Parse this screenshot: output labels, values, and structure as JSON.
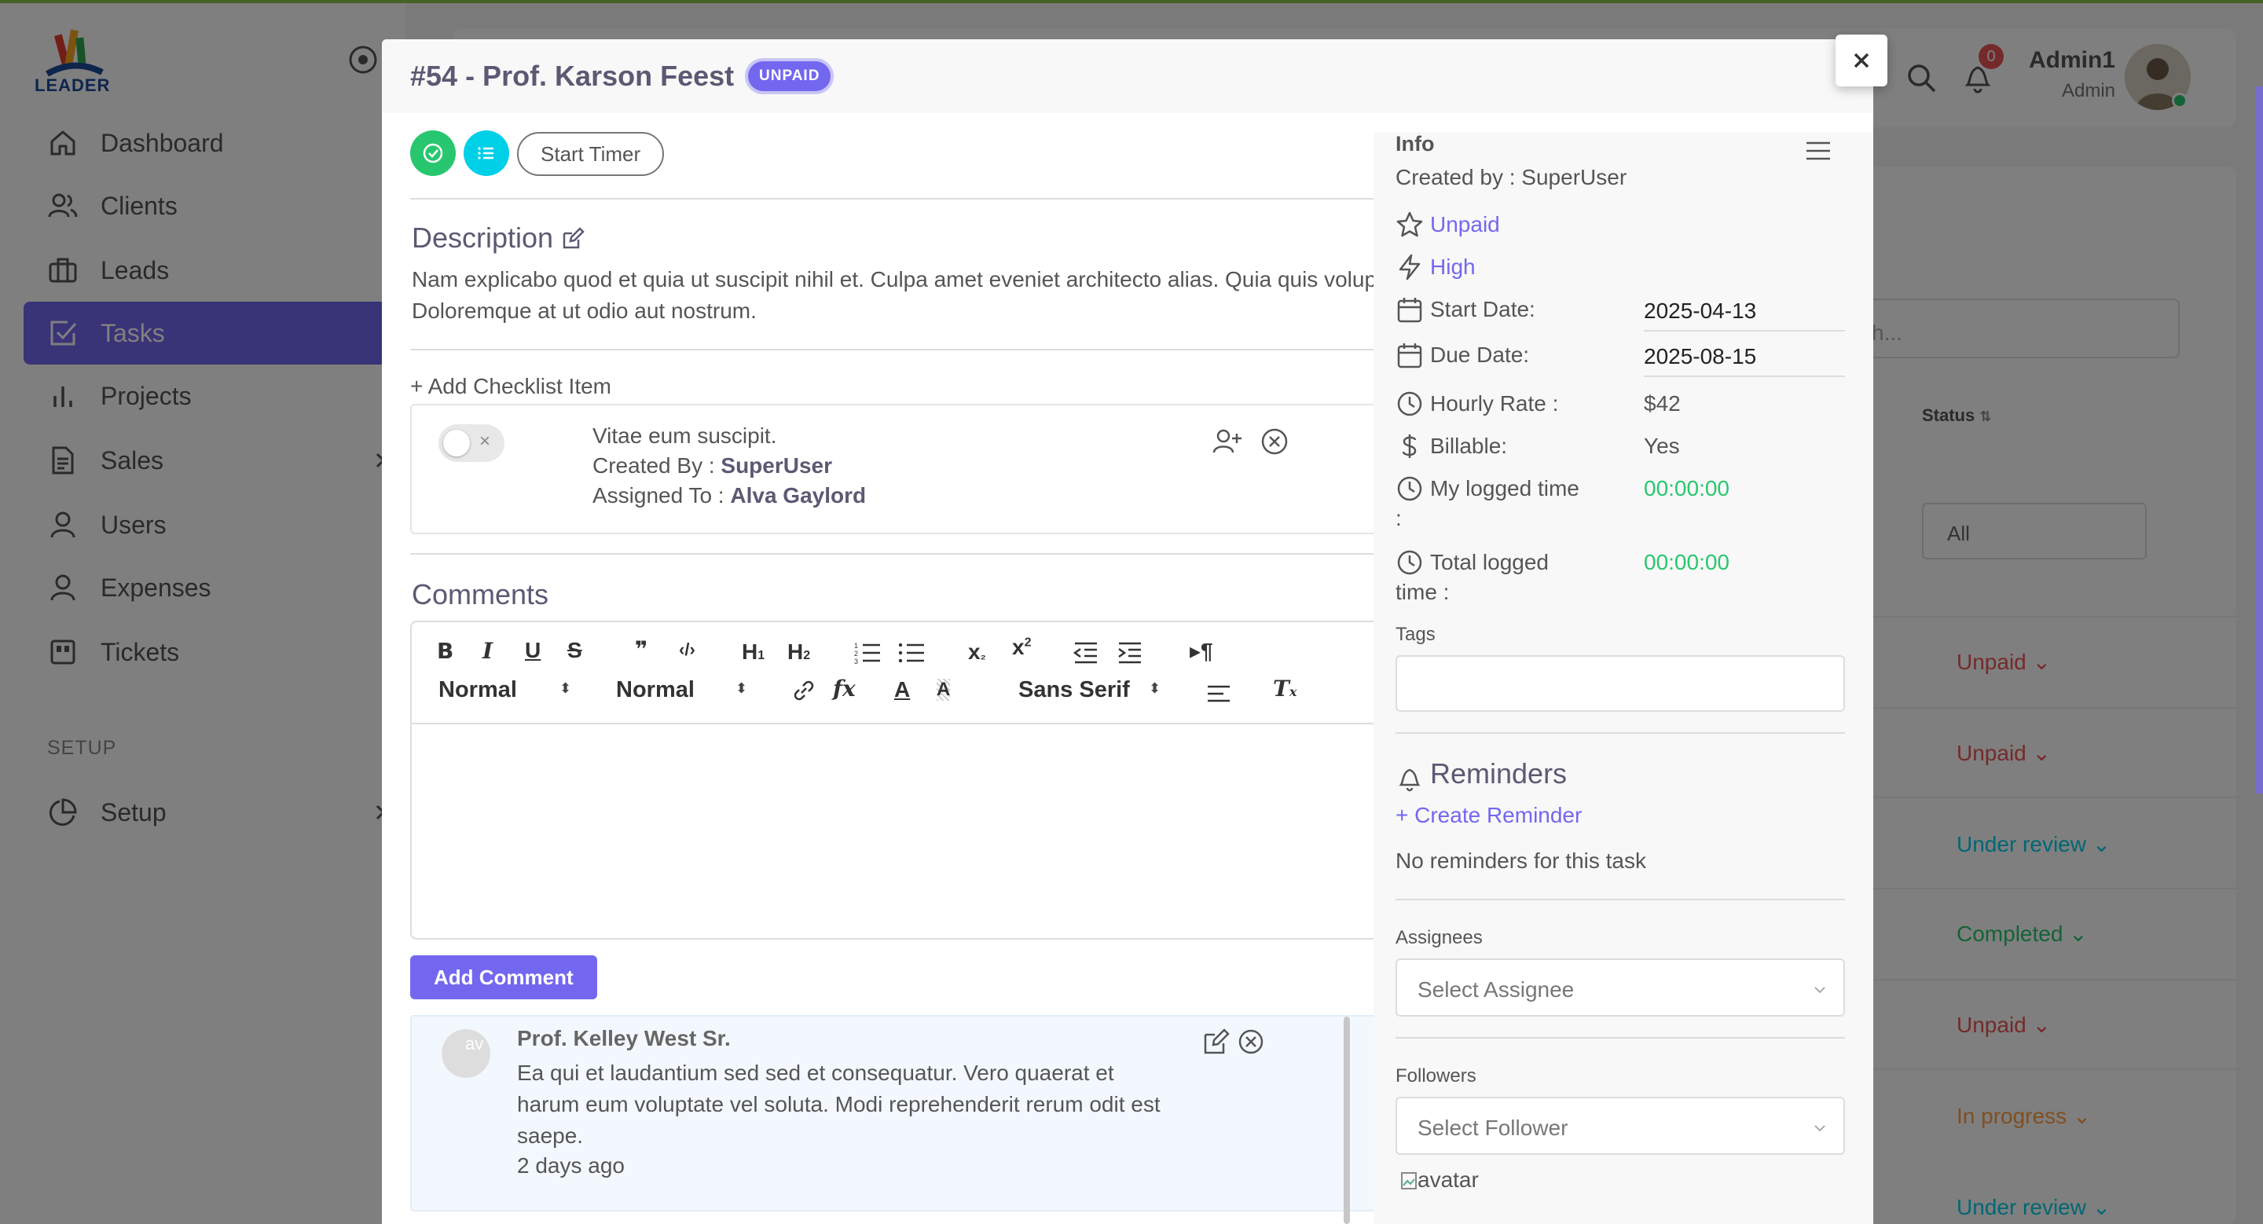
{
  "app": {
    "logo_text": "LEADER",
    "sidebar": {
      "items": [
        {
          "label": "Dashboard",
          "icon": "home-icon"
        },
        {
          "label": "Clients",
          "icon": "users-icon"
        },
        {
          "label": "Leads",
          "icon": "briefcase-icon"
        },
        {
          "label": "Tasks",
          "icon": "check-square-icon",
          "active": true
        },
        {
          "label": "Projects",
          "icon": "bar-chart-icon"
        },
        {
          "label": "Sales",
          "icon": "file-text-icon",
          "has_children": true
        },
        {
          "label": "Users",
          "icon": "user-icon"
        },
        {
          "label": "Expenses",
          "icon": "user-icon"
        },
        {
          "label": "Tickets",
          "icon": "ticket-icon"
        }
      ],
      "setup_heading": "SETUP",
      "setup_item": {
        "label": "Setup",
        "icon": "pie-chart-icon",
        "has_children": true
      }
    },
    "header": {
      "notification_count": "0",
      "user_name": "Admin1",
      "user_role": "Admin"
    },
    "background_table": {
      "search_placeholder": "h...",
      "status_header": "Status",
      "status_filter": "All",
      "statuses": [
        {
          "label": "Unpaid",
          "color": "#ea5455"
        },
        {
          "label": "Unpaid",
          "color": "#ea5455"
        },
        {
          "label": "Under review",
          "color": "#00cfe8"
        },
        {
          "label": "Completed",
          "color": "#28c76f"
        },
        {
          "label": "Unpaid",
          "color": "#ea5455"
        },
        {
          "label": "In progress",
          "color": "#ff9f43"
        },
        {
          "label": "Under review",
          "color": "#00cfe8"
        }
      ]
    }
  },
  "modal": {
    "title": "#54 - Prof. Karson Feest",
    "status_pill": "UNPAID",
    "start_timer_label": "Start Timer",
    "description": {
      "title": "Description",
      "text": "Nam explicabo quod et quia ut suscipit nihil et. Culpa amet eveniet architecto alias. Quia quis voluptas nisi labore cum et qui. Doloremque at ut odio aut nostrum."
    },
    "checklist": {
      "add_label": "+ Add Checklist Item",
      "item": {
        "text": "Vitae eum suscipit.",
        "created_by_label": "Created By : ",
        "created_by": "SuperUser",
        "assigned_to_label": "Assigned To : ",
        "assigned_to": "Alva Gaylord"
      }
    },
    "comments": {
      "title": "Comments",
      "toolbar": {
        "header_select": "Normal",
        "size_select": "Normal",
        "font_select": "Sans Serif"
      },
      "add_button": "Add Comment",
      "items": [
        {
          "avatar_alt": "av",
          "author": "Prof. Kelley West Sr.",
          "body": "Ea qui et laudantium sed sed et consequatur. Vero quaerat et harum eum voluptate vel soluta. Modi reprehenderit rerum odit est saepe.",
          "time": "2 days ago"
        }
      ]
    },
    "info": {
      "title": "Info",
      "created_by": "Created by : SuperUser",
      "status": "Unpaid",
      "priority": "High",
      "start_date_label": "Start Date:",
      "start_date": "2025-04-13",
      "due_date_label": "Due Date:",
      "due_date": "2025-08-15",
      "hourly_rate_label": "Hourly Rate :",
      "hourly_rate": "$42",
      "billable_label": "Billable:",
      "billable": "Yes",
      "my_logged_label_1": "My logged time",
      "my_logged_label_2": ":",
      "my_logged": "00:00:00",
      "total_logged_label_1": "Total logged",
      "total_logged_label_2": "time :",
      "total_logged": "00:00:00",
      "tags_label": "Tags",
      "reminders_title": "Reminders",
      "create_reminder": "+ Create Reminder",
      "no_reminders": "No reminders for this task",
      "assignees_label": "Assignees",
      "assignee_placeholder": "Select Assignee",
      "followers_label": "Followers",
      "follower_placeholder": "Select Follower",
      "follower_avatar_alt": "avatar"
    }
  },
  "colors": {
    "accent": "#7367f0",
    "success": "#28c76f",
    "info": "#00cfe8",
    "danger": "#ea5455",
    "warning": "#ff9f43"
  }
}
